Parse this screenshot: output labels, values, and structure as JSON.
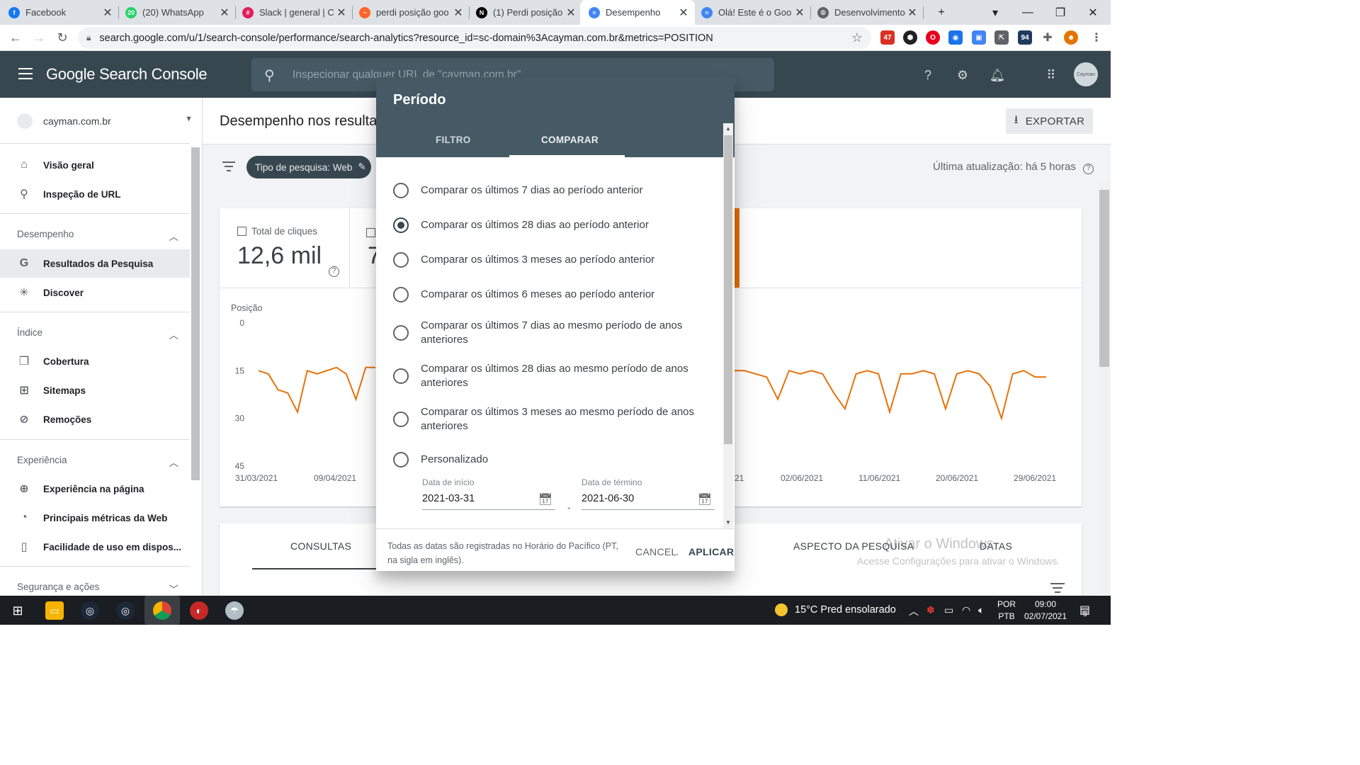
{
  "browser": {
    "tabs": [
      {
        "title": "Facebook",
        "fav_color": "#1877f2",
        "fav_glyph": "f"
      },
      {
        "title": "(20) WhatsApp",
        "fav_color": "#25d366",
        "fav_glyph": "20"
      },
      {
        "title": "Slack | general | C",
        "fav_color": "#e01e5a",
        "fav_glyph": "#"
      },
      {
        "title": "perdi posição goo",
        "fav_color": "#ff642d",
        "fav_glyph": "~"
      },
      {
        "title": "(1) Perdi posição",
        "fav_color": "#000000",
        "fav_glyph": "N"
      },
      {
        "title": "Desempenho",
        "fav_color": "#4285f4",
        "fav_glyph": "≈"
      },
      {
        "title": "Olá! Este é o Goo",
        "fav_color": "#4285f4",
        "fav_glyph": "≈"
      },
      {
        "title": "Desenvolvimento",
        "fav_color": "#5f6368",
        "fav_glyph": "◍"
      }
    ],
    "active_tab_index": 5,
    "url": "search.google.com/u/1/search-console/performance/search-analytics?resource_id=sc-domain%3Acayman.com.br&metrics=POSITION",
    "ext_badge_1": "47",
    "ext_badge_2": "94"
  },
  "gsc": {
    "logo": "Google Search Console",
    "search_placeholder": "Inspecionar qualquer URL de \"cayman.com.br\"",
    "avatar_text": "Cayman"
  },
  "sidebar": {
    "property": "cayman.com.br",
    "top_items": [
      {
        "label": "Visão geral",
        "icon": "home-icon"
      },
      {
        "label": "Inspeção de URL",
        "icon": "search-icon"
      }
    ],
    "sections": [
      {
        "title": "Desempenho",
        "items": [
          {
            "label": "Resultados da Pesquisa",
            "icon": "google-g-icon",
            "selected": true
          },
          {
            "label": "Discover",
            "icon": "asterisk-icon"
          }
        ]
      },
      {
        "title": "Índice",
        "items": [
          {
            "label": "Cobertura",
            "icon": "copy-icon"
          },
          {
            "label": "Sitemaps",
            "icon": "sitemap-icon"
          },
          {
            "label": "Remoções",
            "icon": "eye-off-icon"
          }
        ]
      },
      {
        "title": "Experiência",
        "items": [
          {
            "label": "Experiência na página",
            "icon": "plus-circle-icon"
          },
          {
            "label": "Principais métricas da Web",
            "icon": "gauge-icon"
          },
          {
            "label": "Facilidade de uso em dispos...",
            "icon": "phone-icon"
          }
        ]
      },
      {
        "title": "Segurança e ações",
        "items": []
      }
    ]
  },
  "main": {
    "page_title": "Desempenho nos resulta",
    "export_label": "EXPORTAR",
    "chip_label": "Tipo de pesquisa: Web",
    "last_update": "Última atualização: há 5 horas",
    "metric1_label": "Total de cliques",
    "metric1_value": "12,6 mil",
    "metric2_value": "7",
    "bottom_tabs": [
      "CONSULTAS",
      "ASPECTO DA PESQUISA",
      "DATAS"
    ]
  },
  "chart_data": {
    "type": "line",
    "ylabel": "Posição",
    "y_ticks": [
      "0",
      "15",
      "30",
      "45"
    ],
    "ylim": [
      0,
      45
    ],
    "y_reversed": true,
    "x_ticks": [
      "31/03/2021",
      "09/04/2021",
      "21",
      "02/06/2021",
      "11/06/2021",
      "20/06/2021",
      "29/06/2021"
    ],
    "color": "#e8710a",
    "series_visible_left": [
      15,
      16,
      21,
      22,
      28,
      15,
      16,
      15,
      14,
      16,
      24,
      14,
      14
    ],
    "series_visible_right": [
      15,
      15,
      16,
      17,
      24,
      15,
      16,
      15,
      16,
      22,
      27,
      16,
      15,
      16,
      28,
      16,
      16,
      15,
      16,
      27,
      16,
      15,
      16,
      20,
      30,
      16,
      15,
      17,
      17
    ]
  },
  "dialog": {
    "title": "Período",
    "tabs": [
      "FILTRO",
      "COMPARAR"
    ],
    "active_tab": "COMPARAR",
    "options": [
      {
        "label": "Comparar os últimos 7 dias ao período anterior",
        "selected": false
      },
      {
        "label": "Comparar os últimos 28 dias ao período anterior",
        "selected": true
      },
      {
        "label": "Comparar os últimos 3 meses ao período anterior",
        "selected": false
      },
      {
        "label": "Comparar os últimos 6 meses ao período anterior",
        "selected": false
      },
      {
        "label": "Comparar os últimos 7 dias ao mesmo período de anos anteriores",
        "selected": false
      },
      {
        "label": "Comparar os últimos 28 dias ao mesmo período de anos anteriores",
        "selected": false
      },
      {
        "label": "Comparar os últimos 3 meses ao mesmo período de anos anteriores",
        "selected": false
      },
      {
        "label": "Personalizado",
        "selected": false
      }
    ],
    "start_label": "Data de início",
    "start_value": "2021-03-31",
    "end_label": "Data de término",
    "end_value": "2021-06-30",
    "date_separator": "-",
    "timezone_note": "Todas as datas são registradas no Horário do Pacífico (PT, na sigla em inglês).",
    "cancel_label": "CANCELAR",
    "apply_label": "APLICAR"
  },
  "watermark": {
    "line1": "Ativar o Windows",
    "line2": "Acesse Configurações para ativar o Windows."
  },
  "taskbar": {
    "weather": "15°C  Pred ensolarado",
    "lang_line1": "POR",
    "lang_line2": "PTB",
    "time": "09:00",
    "date": "02/07/2021",
    "notif_count": "5"
  }
}
